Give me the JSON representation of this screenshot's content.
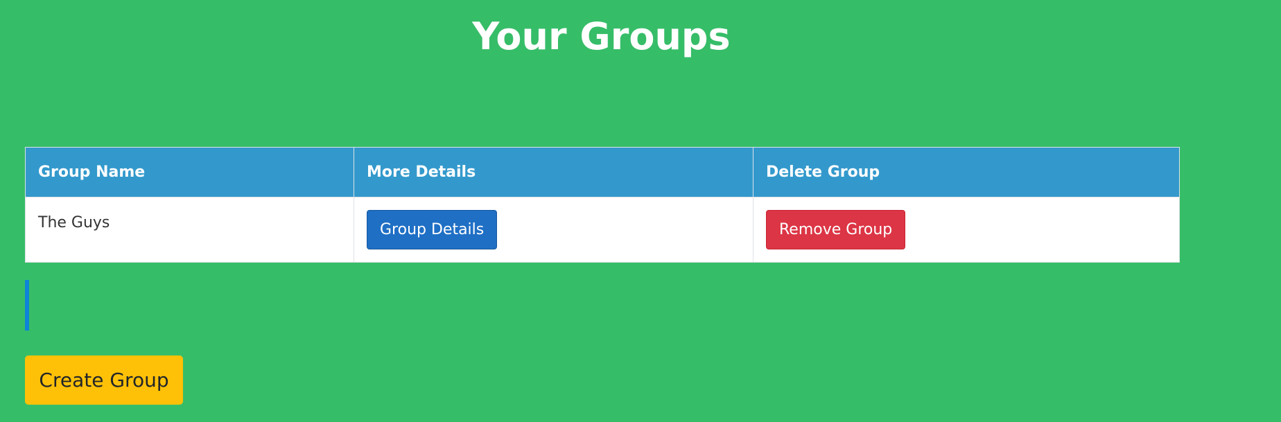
{
  "header": {
    "title": "Your Groups"
  },
  "table": {
    "columns": [
      "Group Name",
      "More Details",
      "Delete Group"
    ],
    "rows": [
      {
        "name": "The Guys",
        "details_button": "Group Details",
        "remove_button": "Remove Group"
      }
    ]
  },
  "actions": {
    "create_label": "Create Group"
  },
  "colors": {
    "background": "#36bd68",
    "header": "#3399cc",
    "details_button": "#1f6fc5",
    "remove_button": "#dc3545",
    "create_button": "#ffc107",
    "accent_bar": "#0d84d9"
  }
}
